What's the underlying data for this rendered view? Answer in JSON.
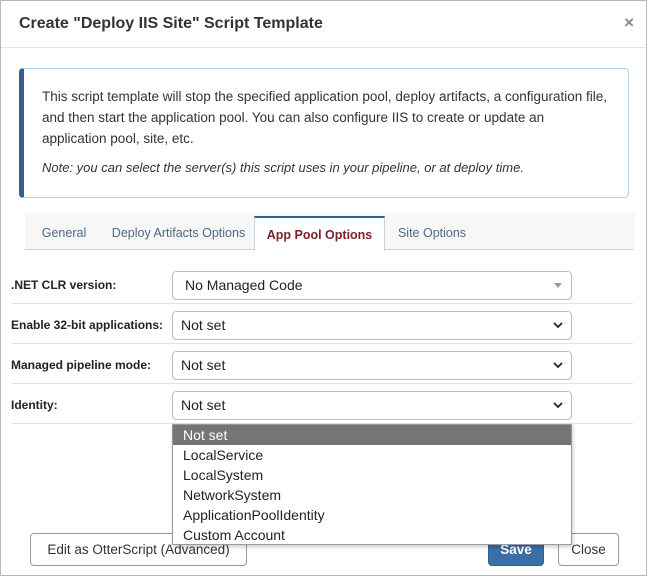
{
  "dialog": {
    "title": "Create \"Deploy IIS Site\" Script Template",
    "close_symbol": "×"
  },
  "info": {
    "description": "This script template will stop the specified application pool, deploy artifacts, a configuration file, and then start the application pool. You can also configure IIS to create or update an application pool, site, etc.",
    "note": "Note: you can select the server(s) this script uses in your pipeline, or at deploy time.",
    "accent_color": "#2e5f95"
  },
  "tabs": [
    {
      "label": "General",
      "active": false
    },
    {
      "label": "Deploy Artifacts Options",
      "active": false
    },
    {
      "label": "App Pool Options",
      "active": true
    },
    {
      "label": "Site Options",
      "active": false
    }
  ],
  "fields": [
    {
      "label": ".NET CLR version:",
      "value": "No Managed Code",
      "icon": "caret-down-icon"
    },
    {
      "label": "Enable 32-bit applications:",
      "value": "Not set",
      "icon": "chevron-down-icon"
    },
    {
      "label": "Managed pipeline mode:",
      "value": "Not set",
      "icon": "chevron-down-icon"
    },
    {
      "label": "Identity:",
      "value": "Not set",
      "icon": "chevron-down-icon"
    }
  ],
  "identity_dropdown": {
    "options": [
      "Not set",
      "LocalService",
      "LocalSystem",
      "NetworkSystem",
      "ApplicationPoolIdentity",
      "Custom Account"
    ],
    "highlighted": "Not set",
    "highlight_color": "#757575"
  },
  "buttons": {
    "edit": "Edit as OtterScript (Advanced)",
    "save": "Save",
    "close": "Close",
    "save_color": "#3a6fa5"
  }
}
